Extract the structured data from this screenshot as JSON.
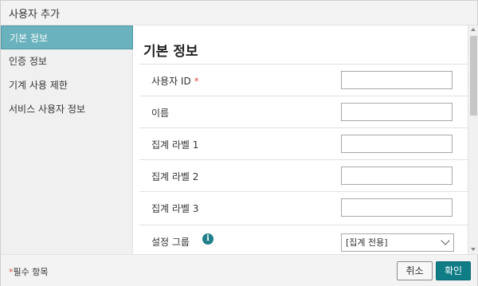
{
  "dialog": {
    "title": "사용자 추가"
  },
  "sidebar": {
    "items": [
      {
        "label": "기본 정보",
        "active": true
      },
      {
        "label": "인증 정보",
        "active": false
      },
      {
        "label": "기계 사용 제한",
        "active": false
      },
      {
        "label": "서비스 사용자 정보",
        "active": false
      }
    ]
  },
  "main": {
    "section_title": "기본 정보",
    "fields": [
      {
        "label": "사용자 ID",
        "required_mark": "*",
        "value": ""
      },
      {
        "label": "이름",
        "value": ""
      },
      {
        "label": "집계 라벨 1",
        "value": ""
      },
      {
        "label": "집계 라벨 2",
        "value": ""
      },
      {
        "label": "집계 라벨 3",
        "value": ""
      }
    ],
    "setting_group": {
      "label": "설정 그룹",
      "info_icon": "info-icon",
      "selected": "[집계 전용]"
    }
  },
  "footer": {
    "required_mark": "*",
    "required_note": "필수 항목",
    "cancel_label": "취소",
    "ok_label": "확인"
  },
  "colors": {
    "accent": "#0f7c86",
    "sidebar_active": "#6ab2bd",
    "required": "#d9534f"
  }
}
